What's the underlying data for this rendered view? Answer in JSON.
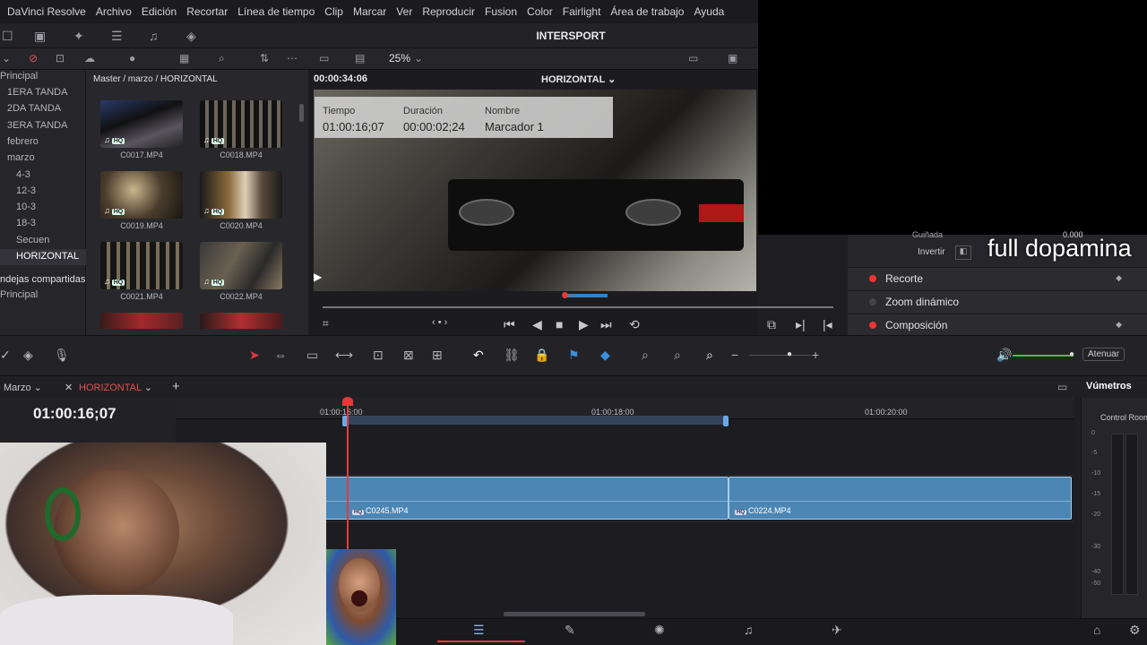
{
  "menubar": {
    "items": [
      "DaVinci Resolve",
      "Archivo",
      "Edición",
      "Recortar",
      "Línea de tiempo",
      "Clip",
      "Marcar",
      "Ver",
      "Reproducir",
      "Fusion",
      "Color",
      "Fairlight",
      "Área de trabajo",
      "Ayuda"
    ]
  },
  "project": {
    "title": "INTERSPORT"
  },
  "media_toolbar": {
    "zoom": "25%"
  },
  "bins": {
    "items": [
      {
        "label": "Principal"
      },
      {
        "label": "1ERA TANDA"
      },
      {
        "label": "2DA TANDA"
      },
      {
        "label": "3ERA TANDA"
      },
      {
        "label": "febrero"
      },
      {
        "label": "marzo"
      },
      {
        "label": "4-3"
      },
      {
        "label": "12-3"
      },
      {
        "label": "10-3"
      },
      {
        "label": "18-3"
      },
      {
        "label": "Secuen"
      },
      {
        "label": "HORIZONTAL"
      },
      {
        "label": "ndejas compartidas"
      },
      {
        "label": "Principal"
      }
    ]
  },
  "media_pool": {
    "path": "Master / marzo / HORIZONTAL",
    "badge": "HQ",
    "clips": [
      {
        "name": "C0017.MP4"
      },
      {
        "name": "C0018.MP4"
      },
      {
        "name": "C0019.MP4"
      },
      {
        "name": "C0020.MP4"
      },
      {
        "name": "C0021.MP4"
      },
      {
        "name": "C0022.MP4"
      }
    ]
  },
  "viewer": {
    "timecode": "00:00:34:06",
    "timeline_name": "HORIZONTAL",
    "marker": {
      "time_label": "Tiempo",
      "time_value": "01:00:16;07",
      "duration_label": "Duración",
      "duration_value": "00:00:02;24",
      "name_label": "Nombre",
      "name_value": "Marcador 1"
    }
  },
  "inspector": {
    "partial_label": "Guiñada",
    "partial_value": "0.000",
    "invert_label": "Invertir",
    "rows": [
      {
        "label": "Recorte",
        "enabled": true
      },
      {
        "label": "Zoom dinámico",
        "enabled": false
      },
      {
        "label": "Composición",
        "enabled": true
      }
    ]
  },
  "overlay": {
    "text": "full dopamina"
  },
  "audio": {
    "mute_label": "Atenuar",
    "volume_level": 0.95
  },
  "timeline": {
    "tab_prev": "Marzo",
    "tab_active": "HORIZONTAL",
    "timecode": "01:00:16;07",
    "ruler_labels": [
      "01:00:16:00",
      "01:00:18:00",
      "01:00:20:00"
    ],
    "clips": [
      {
        "name": "C0245.MP4"
      },
      {
        "name": "C0224.MP4"
      }
    ]
  },
  "vumeter": {
    "title": "Vúmetros",
    "subtitle": "Control Room",
    "scale": [
      "0",
      "-5",
      "-10",
      "-15",
      "-20",
      "-30",
      "-40",
      "-50"
    ]
  },
  "colors": {
    "accent_red": "#e63a3a",
    "clip_blue": "#4b86b4",
    "volume_green": "#2ecc40"
  }
}
